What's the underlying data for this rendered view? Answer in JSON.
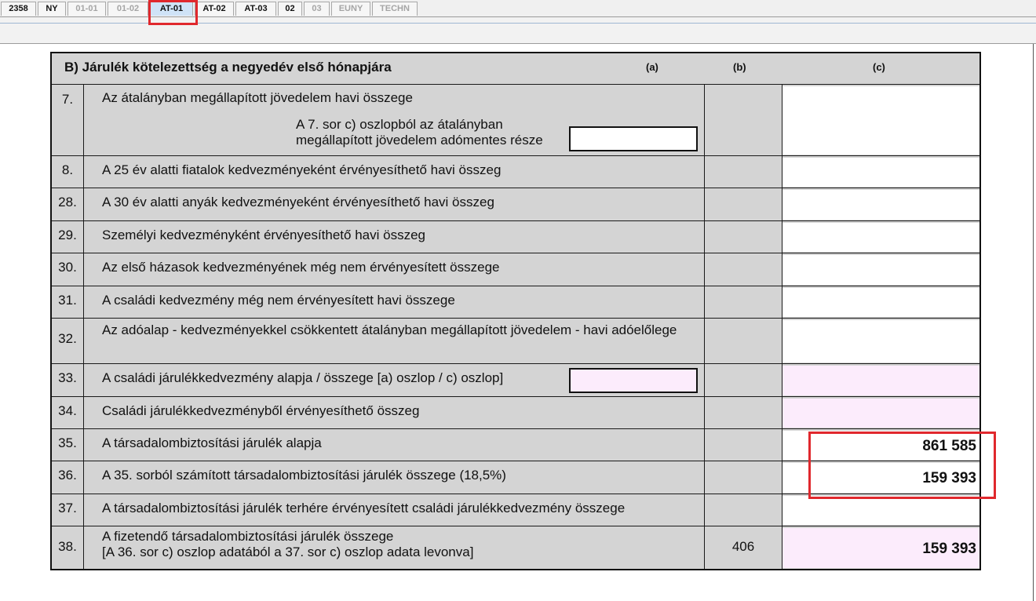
{
  "tabs": [
    {
      "label": "2358",
      "state": "normal"
    },
    {
      "label": "NY",
      "state": "normal"
    },
    {
      "label": "01-01",
      "state": "disabled"
    },
    {
      "label": "01-02",
      "state": "disabled"
    },
    {
      "label": "AT-01",
      "state": "active"
    },
    {
      "label": "AT-02",
      "state": "normal"
    },
    {
      "label": "AT-03",
      "state": "normal"
    },
    {
      "label": "02",
      "state": "normal"
    },
    {
      "label": "03",
      "state": "disabled"
    },
    {
      "label": "EUNY",
      "state": "disabled"
    },
    {
      "label": "TECHN",
      "state": "disabled"
    }
  ],
  "section": {
    "title": "B) Járulék kötelezettség a negyedév első hónapjára",
    "col_a": "(a)",
    "col_b": "(b)",
    "col_c": "(c)"
  },
  "rows": [
    {
      "num": "7.",
      "desc": "Az átalányban megállapított jövedelem havi összege",
      "sub": "A 7. sor c) oszlopból az átalányban megállapított jövedelem adómentes része",
      "b": "",
      "c": ""
    },
    {
      "num": "8.",
      "desc": "A 25 év alatti fiatalok kedvezményeként érvényesíthető havi összeg",
      "b": "",
      "c": ""
    },
    {
      "num": "28.",
      "desc": "A 30 év alatti anyák kedvezményeként érvényesíthető havi összeg",
      "b": "",
      "c": ""
    },
    {
      "num": "29.",
      "desc": "Személyi kedvezményként érvényesíthető havi összeg",
      "b": "",
      "c": ""
    },
    {
      "num": "30.",
      "desc": "Az első házasok kedvezményének még nem érvényesített összege",
      "b": "",
      "c": ""
    },
    {
      "num": "31.",
      "desc": "A családi kedvezmény még nem érvényesített havi összege",
      "b": "",
      "c": ""
    },
    {
      "num": "32.",
      "desc": "Az adóalap - kedvezményekkel csökkentett átalányban megállapított jövedelem - havi adóelőlege",
      "b": "",
      "c": ""
    },
    {
      "num": "33.",
      "desc": "A családi járulékkedvezmény alapja / összege [a) oszlop / c) oszlop]",
      "b": "",
      "c": ""
    },
    {
      "num": "34.",
      "desc": "Családi járulékkedvezményből érvényesíthető összeg",
      "b": "",
      "c": ""
    },
    {
      "num": "35.",
      "desc": "A társadalombiztosítási járulék alapja",
      "b": "",
      "c": "861 585"
    },
    {
      "num": "36.",
      "desc": "A 35. sorból számított társadalombiztosítási járulék összege (18,5%)",
      "b": "",
      "c": "159 393"
    },
    {
      "num": "37.",
      "desc": "A társadalombiztosítási járulék terhére érvényesített családi járulékkedvezmény összege",
      "b": "",
      "c": ""
    },
    {
      "num": "38.",
      "desc": "A fizetendő társadalombiztosítási járulék összege\n[A 36. sor c) oszlop adatából a 37. sor c) oszlop adata levonva]",
      "b": "406",
      "c": "159 393"
    }
  ],
  "colors": {
    "highlight": "#e0282d",
    "pink_field": "#fcecfc",
    "active_tab": "#cfe3f7"
  }
}
